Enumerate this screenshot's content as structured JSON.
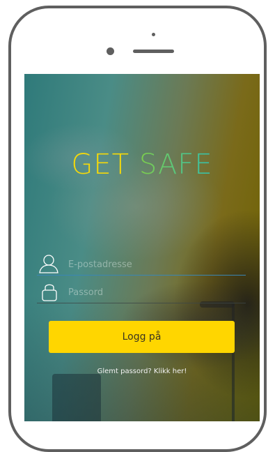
{
  "app": {
    "title_word_1": "GET",
    "title_word_2": "SAFE",
    "brand_colors": {
      "get": "#f5d90a",
      "safe_start": "#7fce4a",
      "safe_end": "#33c0b0",
      "button": "#ffd600"
    }
  },
  "login_form": {
    "email": {
      "placeholder": "E-postadresse",
      "value": "",
      "icon": "user-icon"
    },
    "password": {
      "placeholder": "Passord",
      "value": "",
      "icon": "lock-icon"
    },
    "submit_label": "Logg på",
    "forgot_link": "Glemt passord? Klikk her!"
  }
}
